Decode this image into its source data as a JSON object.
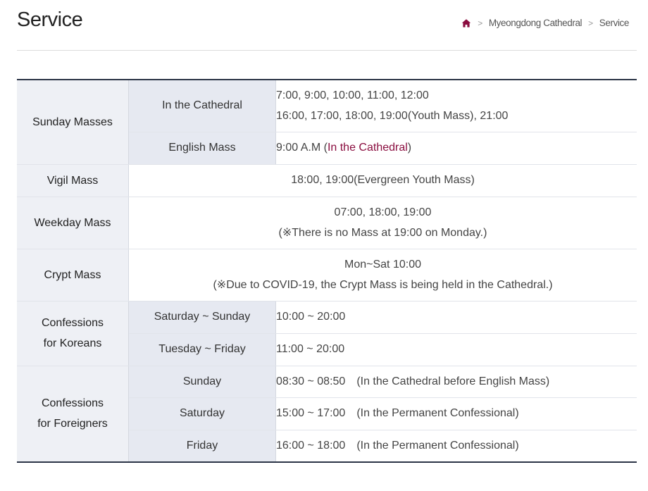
{
  "page": {
    "title": "Service"
  },
  "breadcrumb": {
    "level1": "Myeongdong Cathedral",
    "level2": "Service"
  },
  "colors": {
    "accent": "#8a0d3f",
    "table_border": "#2b3446",
    "category_bg": "#eef0f5",
    "sub_bg": "#e6e9f1"
  },
  "icons": {
    "home": "home-icon"
  },
  "schedule": {
    "sunday": {
      "label": "Sunday Masses",
      "cathedral": {
        "label": "In the Cathedral",
        "line1": "7:00, 9:00, 10:00, 11:00, 12:00",
        "line2": "16:00, 17:00, 18:00, 19:00(Youth Mass), 21:00"
      },
      "english": {
        "label": "English Mass",
        "time": "9:00 A.M",
        "open": " (",
        "place": "In the Cathedral",
        "close": ")"
      }
    },
    "vigil": {
      "label": "Vigil Mass",
      "value": "18:00, 19:00(Evergreen Youth Mass)"
    },
    "weekday": {
      "label": "Weekday Mass",
      "line1": "07:00, 18:00, 19:00",
      "line2": "(※There is no Mass at 19:00 on Monday.)"
    },
    "crypt": {
      "label": "Crypt Mass",
      "line1": "Mon~Sat 10:00",
      "line2": "(※Due to COVID-19, the Crypt Mass is being held in the Cathedral.)"
    },
    "confessions_koreans": {
      "label_line1": "Confessions",
      "label_line2": "for Koreans",
      "rows": [
        {
          "day": "Saturday ~ Sunday",
          "time": "10:00 ~ 20:00"
        },
        {
          "day": "Tuesday ~ Friday",
          "time": "11:00 ~ 20:00"
        }
      ]
    },
    "confessions_foreigners": {
      "label_line1": "Confessions",
      "label_line2": "for Foreigners",
      "rows": [
        {
          "day": "Sunday",
          "time": "08:30 ~ 08:50",
          "note": "(In the Cathedral before English Mass)"
        },
        {
          "day": "Saturday",
          "time": "15:00 ~ 17:00",
          "note": "(In the Permanent Confessional)"
        },
        {
          "day": "Friday",
          "time": "16:00 ~ 18:00",
          "note": "(In the Permanent Confessional)"
        }
      ]
    }
  }
}
